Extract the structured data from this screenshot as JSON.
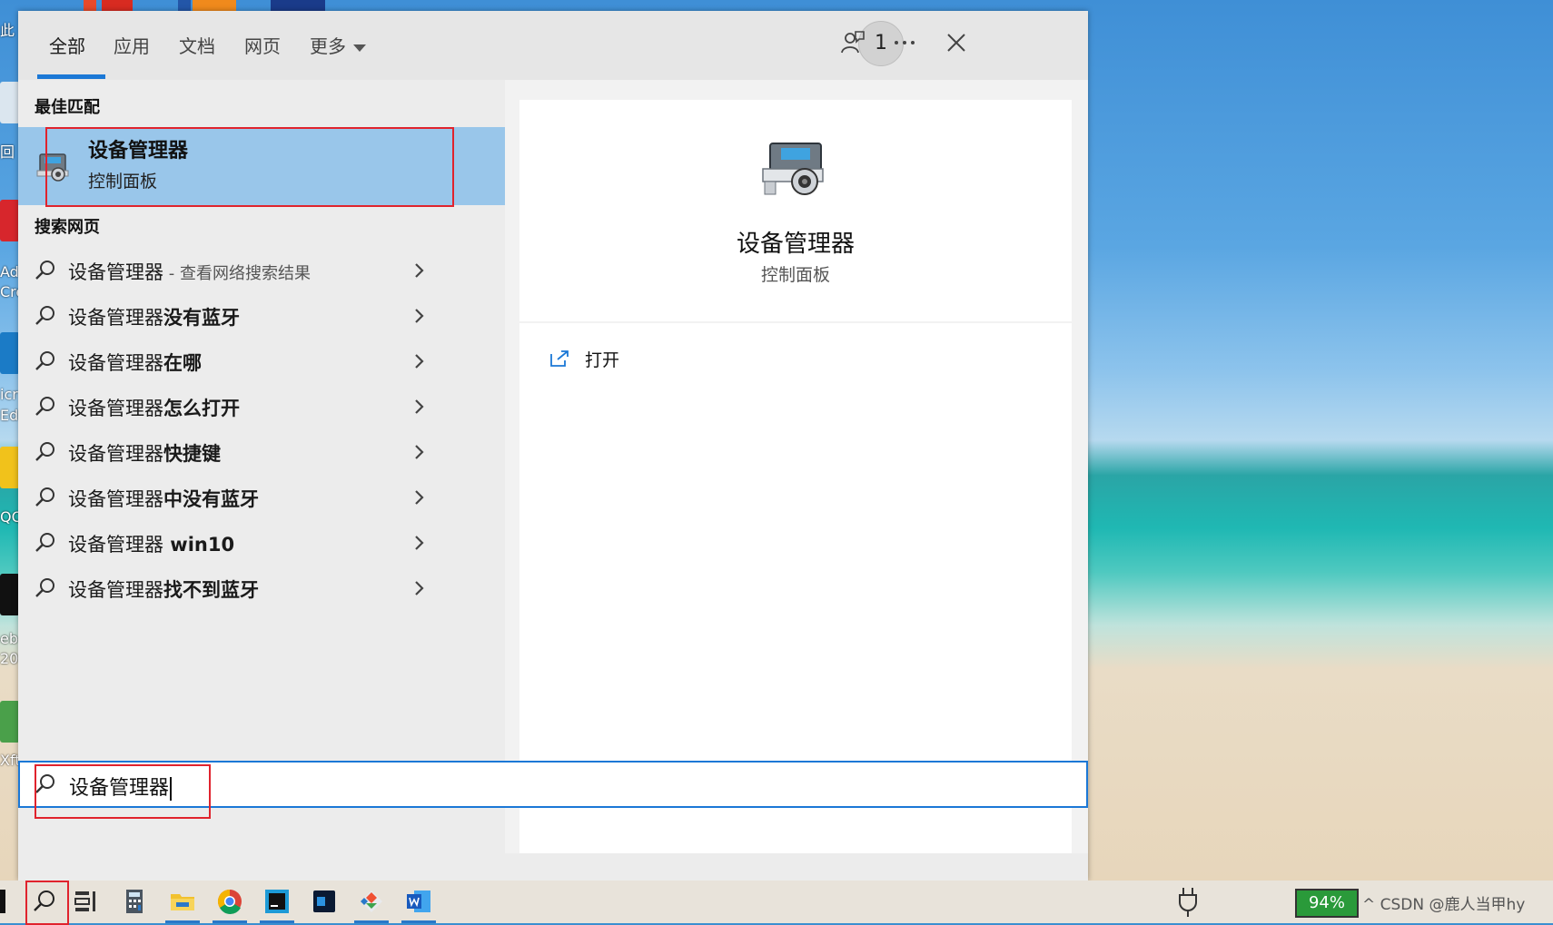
{
  "tabs": {
    "all": "全部",
    "apps": "应用",
    "docs": "文档",
    "web": "网页",
    "more": "更多"
  },
  "toolbar": {
    "badge_count": "1"
  },
  "left": {
    "best_match_heading": "最佳匹配",
    "best_match": {
      "title": "设备管理器",
      "subtitle": "控制面板"
    },
    "web_heading": "搜索网页",
    "web_results": [
      {
        "prefix": "设备管理器",
        "bold": "",
        "suffix": " - 查看网络搜索结果"
      },
      {
        "prefix": "设备管理器",
        "bold": "没有蓝牙",
        "suffix": ""
      },
      {
        "prefix": "设备管理器",
        "bold": "在哪",
        "suffix": ""
      },
      {
        "prefix": "设备管理器",
        "bold": "怎么打开",
        "suffix": ""
      },
      {
        "prefix": "设备管理器",
        "bold": "快捷键",
        "suffix": ""
      },
      {
        "prefix": "设备管理器",
        "bold": "中没有蓝牙",
        "suffix": ""
      },
      {
        "prefix": "设备管理器",
        "bold": " win10",
        "suffix": ""
      },
      {
        "prefix": "设备管理器",
        "bold": "找不到蓝牙",
        "suffix": ""
      }
    ]
  },
  "preview": {
    "title": "设备管理器",
    "subtitle": "控制面板",
    "open_label": "打开"
  },
  "search": {
    "value": "设备管理器"
  },
  "taskbar": {
    "battery": "94%",
    "tray_text": "^ CSDN @鹿人当甲hy"
  },
  "desktop_labels": [
    "此",
    "回",
    "Ad",
    "Cre",
    "icr",
    "Ed",
    "QQ",
    "eb",
    "20",
    "Xft"
  ],
  "colors": {
    "accent": "#1b78d6",
    "highlight": "#99c6ea",
    "annotation_red": "#e0232d"
  }
}
